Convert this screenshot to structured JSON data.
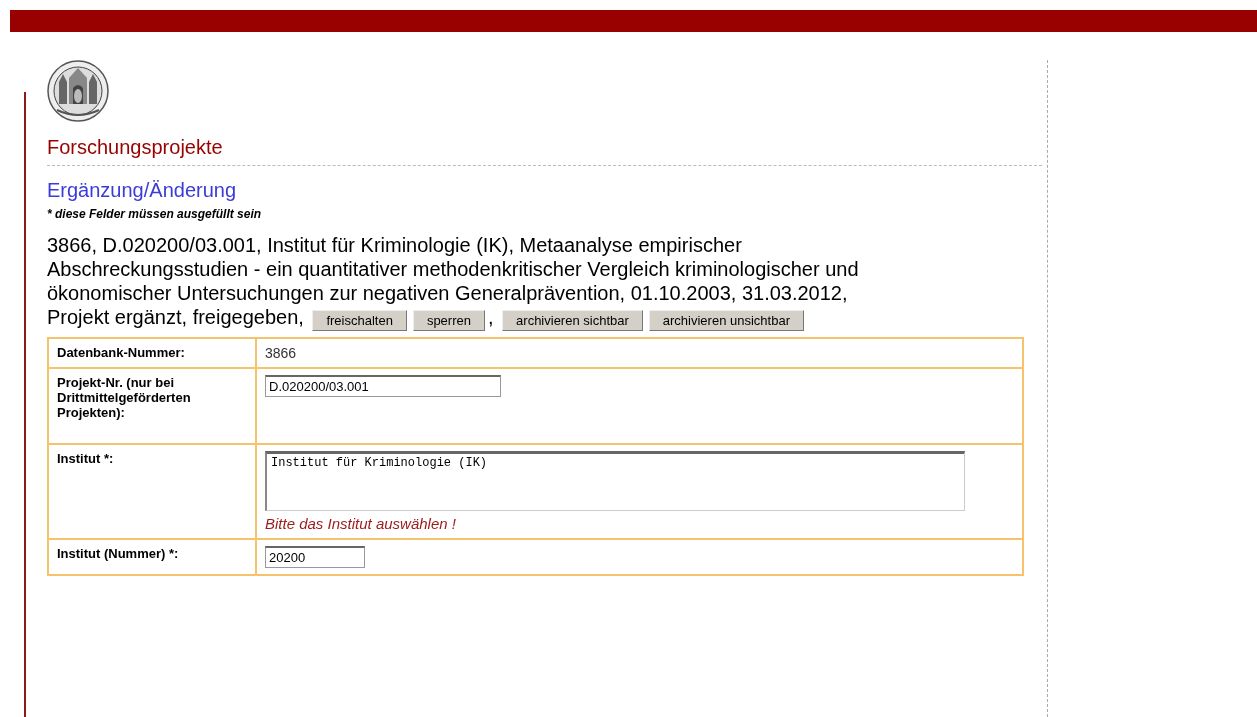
{
  "page_title": "Forschungsprojekte",
  "section_title": "Ergänzung/Änderung",
  "required_note": "* diese Felder müssen ausgefüllt sein",
  "summary": [
    {
      "kind": "line",
      "text": "3866, D.020200/03.001, Institut für Kriminologie (IK), Metaanalyse empirischer"
    },
    {
      "kind": "line",
      "text": "Abschreckungsstudien - ein quantitativer methodenkritischer Vergleich kriminologischer und"
    },
    {
      "kind": "line",
      "text": "ökonomischer Untersuchungen zur negativen Generalprävention, 01.10.2003, 31.03.2012,"
    },
    {
      "kind": "text",
      "text": "Projekt ergänzt, freigegeben,"
    },
    {
      "kind": "button",
      "label": "freischalten"
    },
    {
      "kind": "button",
      "label": "sperren"
    },
    {
      "kind": "text",
      "text": ","
    },
    {
      "kind": "button",
      "label": "archivieren sichtbar"
    },
    {
      "kind": "button",
      "label": "archivieren unsichtbar"
    }
  ],
  "form_rows": [
    {
      "kind": "value",
      "label": "Datenbank-Nummer:",
      "value": "3866"
    },
    {
      "kind": "input",
      "label": "Projekt-Nr. (nur bei Drittmittelgeförderten Projekten):",
      "value": "D.020200/03.001"
    },
    {
      "kind": "textarea",
      "label": "Institut *:",
      "value": "Institut für Kriminologie (IK)",
      "error": "Bitte das Institut auswählen !"
    },
    {
      "kind": "short_input",
      "label": "Institut (Nummer) *:",
      "value": "20200"
    }
  ]
}
